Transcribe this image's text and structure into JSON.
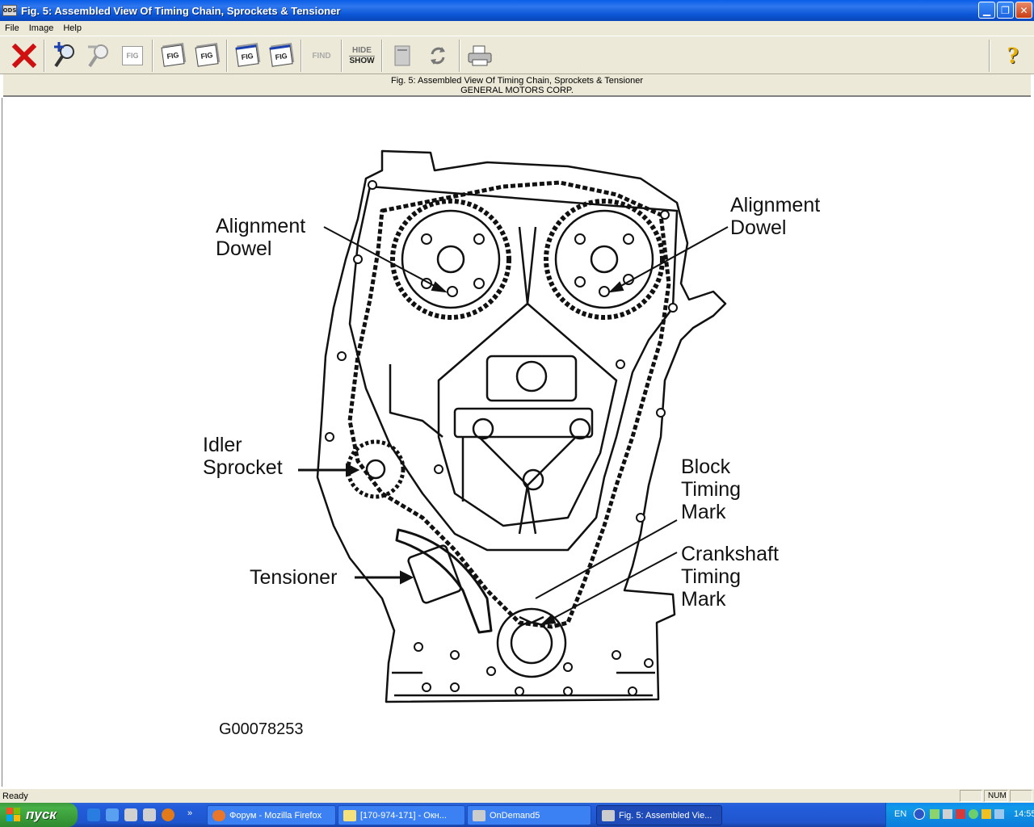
{
  "window": {
    "title": "Fig. 5: Assembled View Of Timing Chain, Sprockets & Tensioner",
    "app_icon_text": "ODS"
  },
  "menu": [
    "File",
    "Image",
    "Help"
  ],
  "toolbar": {
    "buttons": [
      {
        "name": "close-icon",
        "color": "#d01010"
      },
      {
        "name": "zoom-in-icon"
      },
      {
        "name": "zoom-out-icon"
      },
      {
        "name": "fig-disabled-icon"
      },
      {
        "name": "fig-icon"
      },
      {
        "name": "fig-hand-icon"
      },
      {
        "name": "fig-previous-icon"
      },
      {
        "name": "fig-next-icon"
      },
      {
        "name": "find-icon"
      },
      {
        "name": "hide-show-icon"
      },
      {
        "name": "bookmark-icon"
      },
      {
        "name": "refresh-icon"
      },
      {
        "name": "print-icon"
      },
      {
        "name": "help-icon"
      }
    ],
    "fig_text": "FIG",
    "find_text": "FIND",
    "hide_text": "HIDE",
    "show_text": "SHOW",
    "help_text": "?"
  },
  "caption": {
    "line1": "Fig. 5: Assembled View Of Timing Chain, Sprockets & Tensioner",
    "line2": "GENERAL MOTORS CORP."
  },
  "figure": {
    "labels": {
      "alignment_dowel_left_1": "Alignment",
      "alignment_dowel_left_2": "Dowel",
      "alignment_dowel_right_1": "Alignment",
      "alignment_dowel_right_2": "Dowel",
      "idler_sprocket_1": "Idler",
      "idler_sprocket_2": "Sprocket",
      "block_timing_mark_1": "Block",
      "block_timing_mark_2": "Timing",
      "block_timing_mark_3": "Mark",
      "tensioner": "Tensioner",
      "crankshaft_timing_mark_1": "Crankshaft",
      "crankshaft_timing_mark_2": "Timing",
      "crankshaft_timing_mark_3": "Mark"
    },
    "figure_id": "G00078253"
  },
  "status": {
    "text": "Ready",
    "num": "NUM"
  },
  "taskbar": {
    "start_label": "пуск",
    "tasks": [
      "Форум - Mozilla Firefox",
      "[170-974-171] - Окн...",
      "OnDemand5",
      "Fig. 5: Assembled Vie..."
    ],
    "tray_lang": "EN",
    "clock": "14:55"
  }
}
